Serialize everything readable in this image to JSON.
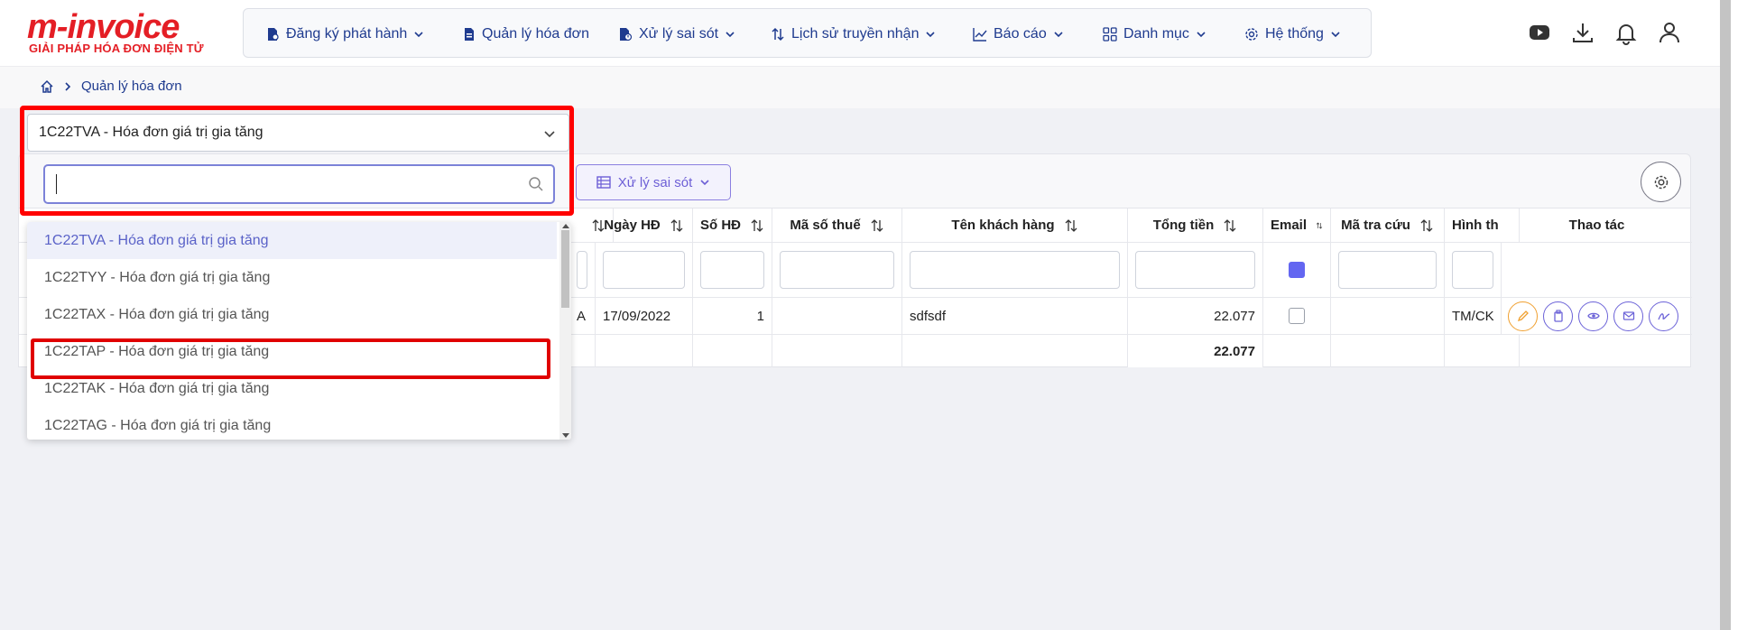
{
  "logo": {
    "brand": "m-invoice",
    "tagline": "GIẢI PHÁP HÓA ĐƠN ĐIỆN TỬ"
  },
  "nav": [
    {
      "label": "Đăng ký phát hành",
      "icon": "file-register-icon",
      "dropdown": true
    },
    {
      "label": "Quản lý hóa đơn",
      "icon": "file-icon",
      "dropdown": false
    },
    {
      "label": "Xử lý sai sót",
      "icon": "file-error-icon",
      "dropdown": true
    },
    {
      "label": "Lịch sử truyền nhận",
      "icon": "sort-arrows-icon",
      "dropdown": true
    },
    {
      "label": "Báo cáo",
      "icon": "chart-line-icon",
      "dropdown": true
    },
    {
      "label": "Danh mục",
      "icon": "grid-icon",
      "dropdown": true
    },
    {
      "label": "Hệ thống",
      "icon": "gear-icon",
      "dropdown": true
    }
  ],
  "breadcrumb": {
    "current": "Quản lý hóa đơn"
  },
  "series_select": {
    "selected": "1C22TVA - Hóa đơn giá trị gia tăng",
    "search_value": "",
    "options": [
      "1C22TVA - Hóa đơn giá trị gia tăng",
      "1C22TYY - Hóa đơn giá trị gia tăng",
      "1C22TAX - Hóa đơn giá trị gia tăng",
      "1C22TAP - Hóa đơn giá trị gia tăng",
      "1C22TAK - Hóa đơn giá trị gia tăng",
      "1C22TAG - Hóa đơn giá trị gia tăng"
    ]
  },
  "toolbar": {
    "error_button": "Xử lý sai sót"
  },
  "table": {
    "headers": {
      "partial": "",
      "date": "Ngày HĐ",
      "number": "Số HĐ",
      "tax_code": "Mã số thuế",
      "customer": "Tên khách hàng",
      "total": "Tổng tiền",
      "email": "Email",
      "lookup": "Mã tra cứu",
      "payment": "Hình th",
      "actions": "Thao tác"
    },
    "row": {
      "partial": "A",
      "date": "17/09/2022",
      "number": "1",
      "tax_code": "",
      "customer": "sdfsdf",
      "total": "22.077",
      "lookup": "",
      "payment": "TM/CK"
    },
    "footer_total": "22.077"
  },
  "colors": {
    "primary": "#1f3b8f",
    "accent": "#6366f1",
    "highlight": "#ff0000"
  }
}
